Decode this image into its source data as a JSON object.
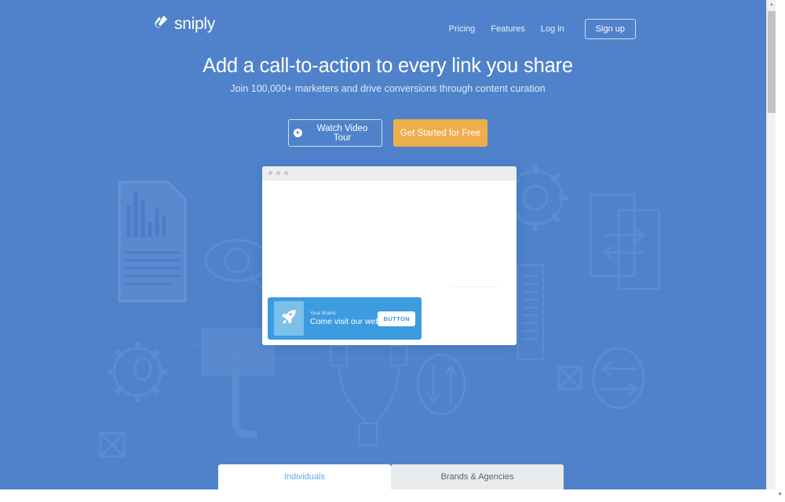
{
  "brand": {
    "name": "sniply",
    "logo_icon": "sniply-ribbon-icon"
  },
  "nav": {
    "links": [
      {
        "label": "Pricing",
        "name": "nav-link-pricing"
      },
      {
        "label": "Features",
        "name": "nav-link-features"
      },
      {
        "label": "Log in",
        "name": "nav-link-login"
      }
    ],
    "signup_label": "Sign up"
  },
  "hero": {
    "headline": "Add a call-to-action to every link you share",
    "subheadline": "Join 100,000+ marketers and drive conversions through content curation",
    "cta_primary": "Get Started for Free",
    "cta_secondary": "Watch Video Tour",
    "play_icon": "play-circle-icon",
    "background_color": "#4f82ca",
    "accent_color": "#efae4c"
  },
  "mockup": {
    "window_dots": 3,
    "snippet": {
      "brand_label": "Your Brand",
      "message": "Come visit our website",
      "button_label": "BUTTON",
      "icon": "rocket-icon",
      "color": "#3d9be0"
    }
  },
  "tabs": [
    {
      "label": "Individuals",
      "active": true
    },
    {
      "label": "Brands & Agencies",
      "active": false
    }
  ],
  "scrollbar": {
    "up_arrow": "▲",
    "down_arrow": "▼",
    "right_arrow": "▼"
  }
}
